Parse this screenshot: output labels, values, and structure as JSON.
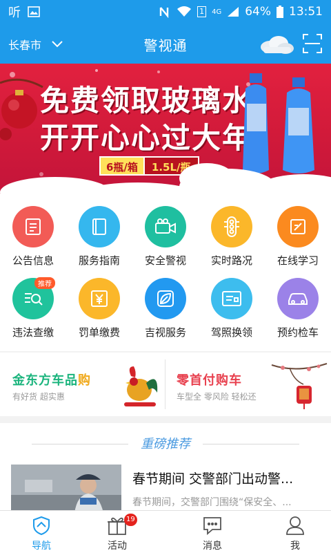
{
  "status_bar": {
    "left_glyph": "听",
    "battery_percent": "64%",
    "time": "13:51",
    "network": "4G",
    "sim_slot": "1",
    "icons": [
      "image-icon",
      "nfc-icon",
      "wifi-icon",
      "signal-icon",
      "battery-icon"
    ]
  },
  "header": {
    "city": "长春市",
    "title": "警视通",
    "icons": [
      "chevron-down-icon",
      "weather-cloud-icon",
      "scan-icon"
    ]
  },
  "banner": {
    "line1": "免费领取玻璃水",
    "line2": "开开心心过大年",
    "badge_qty": "6瓶/箱",
    "badge_vol": "1.5L/瓶",
    "slide_count": 3,
    "active_slide": 1
  },
  "grid": {
    "items": [
      {
        "label": "公告信息",
        "color": "#f25b56",
        "icon": "notice-icon"
      },
      {
        "label": "服务指南",
        "color": "#35b7ee",
        "icon": "book-icon"
      },
      {
        "label": "安全警视",
        "color": "#1fbfa0",
        "icon": "camera-icon"
      },
      {
        "label": "实时路况",
        "color": "#fbb72a",
        "icon": "traffic-light-icon"
      },
      {
        "label": "在线学习",
        "color": "#fb8a1f",
        "icon": "edit-icon"
      },
      {
        "label": "违法查缴",
        "color": "#20c39c",
        "icon": "search-list-icon",
        "tag": "推荐"
      },
      {
        "label": "罚单缴费",
        "color": "#fbb72a",
        "icon": "yuan-ticket-icon"
      },
      {
        "label": "吉视服务",
        "color": "#2299f0",
        "icon": "leaf-icon"
      },
      {
        "label": "驾照换领",
        "color": "#3dbdee",
        "icon": "license-card-icon"
      },
      {
        "label": "预约检车",
        "color": "#9b82e8",
        "icon": "car-icon"
      }
    ]
  },
  "promo": {
    "left": {
      "title": "金东方车品",
      "title_suffix": "购",
      "sub": "有好货  超实惠"
    },
    "right": {
      "title": "零首付购车",
      "sub": "车型全  零风险  轻松还"
    }
  },
  "recommend": {
    "heading": "重磅推荐",
    "news": [
      {
        "title": "春节期间 交警部门出动警...",
        "desc": "春节期间，交警部门围绕“保安全、..."
      }
    ]
  },
  "bottom_nav": {
    "items": [
      {
        "label": "导航",
        "icon": "shield-nav-icon",
        "active": true
      },
      {
        "label": "活动",
        "icon": "gift-icon",
        "badge": "19"
      },
      {
        "label": "消息",
        "icon": "message-icon"
      },
      {
        "label": "我",
        "icon": "user-icon"
      }
    ]
  },
  "colors": {
    "primary": "#1e9bea",
    "banner_red": "#d11a3a",
    "promo_green": "#1bb47d",
    "promo_red": "#e8414f",
    "accent_blue": "#4a9ae0"
  }
}
